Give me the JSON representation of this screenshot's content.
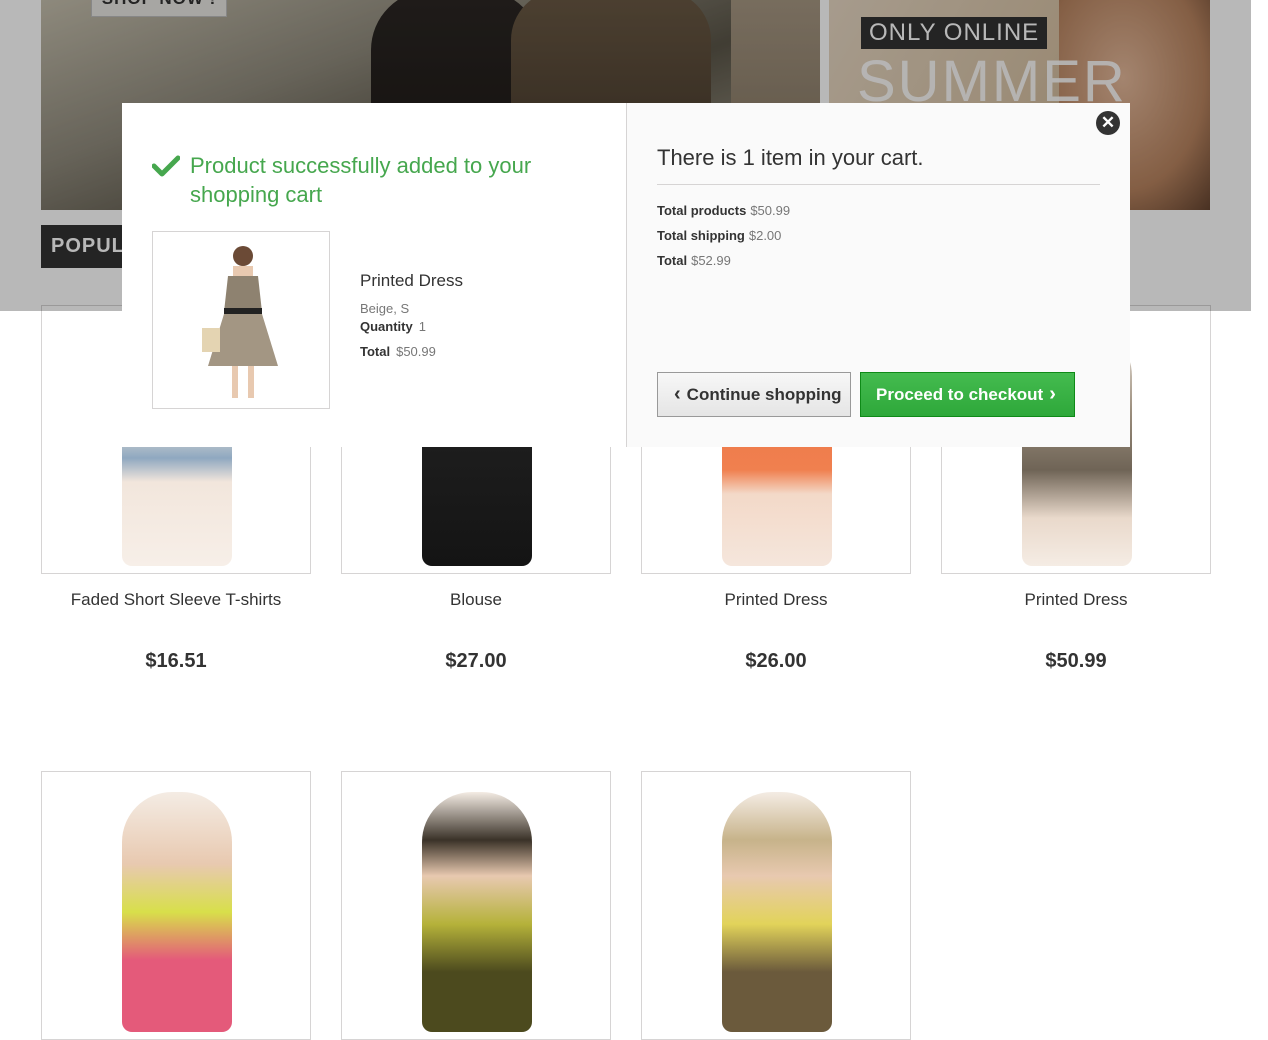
{
  "banner": {
    "shop_now_label": "SHOP NOW !",
    "only_online_label": "ONLY ONLINE",
    "summer_label": "SUMMER"
  },
  "section": {
    "popular_label": "POPULAR"
  },
  "products": [
    {
      "name": "Faded Short Sleeve T-shirts",
      "price": "$16.51"
    },
    {
      "name": "Blouse",
      "price": "$27.00"
    },
    {
      "name": "Printed Dress",
      "price": "$26.00"
    },
    {
      "name": "Printed Dress",
      "price": "$50.99"
    }
  ],
  "layer_cart": {
    "success_message": "Product successfully added to your shopping cart",
    "product_name": "Printed Dress",
    "product_attributes": "Beige, S",
    "quantity_label": "Quantity",
    "quantity_value": "1",
    "total_label": "Total",
    "total_value": "$50.99",
    "cart_count_text": "There is 1 item in your cart.",
    "total_products_label": "Total products",
    "total_products_value": "$50.99",
    "total_shipping_label": "Total shipping",
    "total_shipping_value": "$2.00",
    "grand_total_label": "Total",
    "grand_total_value": "$52.99",
    "continue_label": "Continue shopping",
    "checkout_label": "Proceed to checkout"
  },
  "colors": {
    "success_green": "#46a74e",
    "checkout_green": "#2ea83a",
    "dark": "#333333"
  },
  "icons": {
    "check": "check-icon",
    "close": "close-icon",
    "chevron_left": "chevron-left-icon",
    "chevron_right": "chevron-right-icon"
  }
}
